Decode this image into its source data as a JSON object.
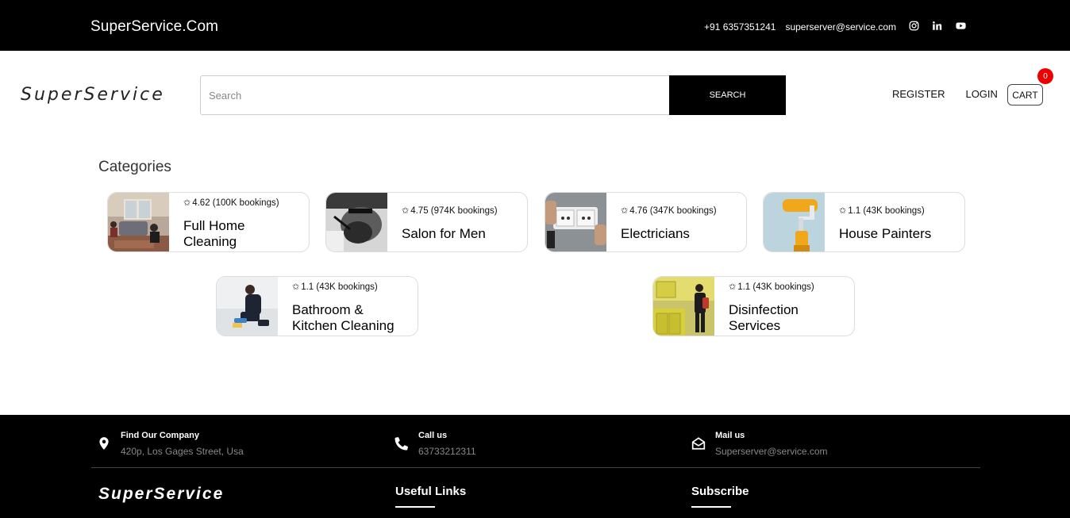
{
  "topbar": {
    "brand": "SuperService.Com",
    "phone": "+91 6357351241",
    "email": "superserver@service.com",
    "social": [
      "instagram-icon",
      "linkedin-icon",
      "youtube-icon"
    ]
  },
  "header": {
    "logo": "SuperService",
    "search_placeholder": "Search",
    "search_button": "SEARCH",
    "register": "REGISTER",
    "login": "LOGIN",
    "cart": "CART",
    "cart_count": "0"
  },
  "categories": {
    "title": "Categories",
    "items": [
      {
        "rating": "4.62 (100K bookings)",
        "name_line1": "Full Home",
        "name_line2": "Cleaning",
        "image": "home-cleaning-photo"
      },
      {
        "rating": "4.75 (974K bookings)",
        "name_line1": "Salon for Men",
        "name_line2": "",
        "image": "salon-photo"
      },
      {
        "rating": "4.76 (347K bookings)",
        "name_line1": "Electricians",
        "name_line2": "",
        "image": "electric-socket-photo"
      },
      {
        "rating": "1.1 (43K bookings)",
        "name_line1": "House Painters",
        "name_line2": "",
        "image": "paint-roller-photo"
      },
      {
        "rating": "1.1 (43K bookings)",
        "name_line1": "Bathroom &",
        "name_line2": "Kitchen Cleaning",
        "image": "floor-cleaning-photo"
      },
      {
        "rating": "1.1 (43K bookings)",
        "name_line1": "Disinfection",
        "name_line2": "Services",
        "image": "disinfection-photo"
      }
    ]
  },
  "footer": {
    "find_title": "Find Our Company",
    "find_value": "420p, Los Gages Street, Usa",
    "call_title": "Call us",
    "call_value": "63733212311",
    "mail_title": "Mail us",
    "mail_value": "Superserver@service.com",
    "logo": "SuperService",
    "useful_links": "Useful Links",
    "subscribe": "Subscribe"
  }
}
